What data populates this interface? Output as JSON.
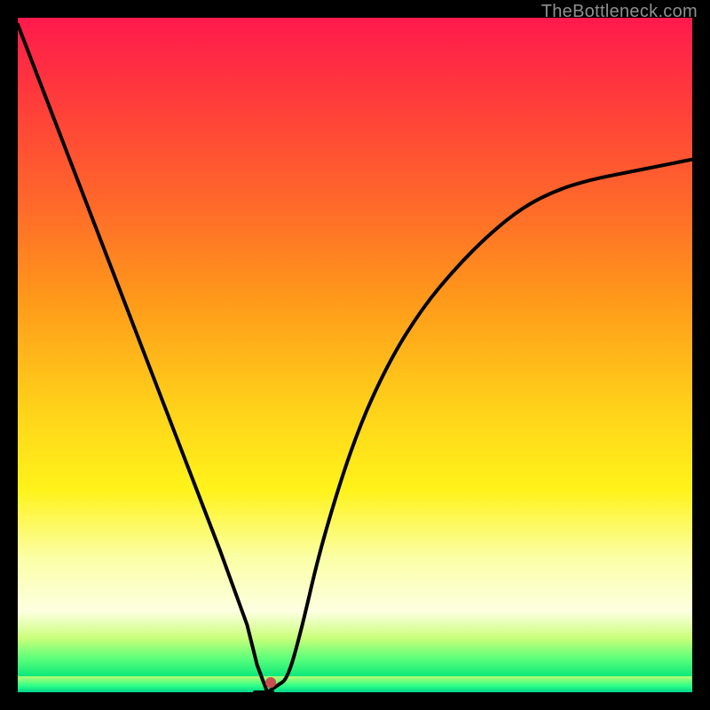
{
  "watermark": {
    "text": "TheBottleneck.com"
  },
  "colors": {
    "black": "#000000",
    "dot": "#c9504e",
    "watermark": "#8f8f8f"
  },
  "dot": {
    "x_frac": 0.375,
    "y_frac": 0.985
  },
  "chart_data": {
    "type": "line",
    "title": "",
    "xlabel": "",
    "ylabel": "",
    "xlim": [
      0,
      1
    ],
    "ylim": [
      0,
      1
    ],
    "note": "Axes not shown; x/y are fractional positions in the plot area. The plotted curve is a V-shaped bottleneck curve with minimum at x≈0.37, y≈0. The left branch is nearly straight, right branch rises concavely.",
    "series": [
      {
        "name": "bottleneck-curve",
        "x": [
          0.0,
          0.05,
          0.1,
          0.15,
          0.2,
          0.25,
          0.3,
          0.34,
          0.355,
          0.37,
          0.385,
          0.4,
          0.42,
          0.45,
          0.5,
          0.55,
          0.6,
          0.65,
          0.7,
          0.75,
          0.8,
          0.85,
          0.9,
          0.95,
          1.0
        ],
        "y": [
          0.99,
          0.86,
          0.73,
          0.6,
          0.47,
          0.34,
          0.21,
          0.1,
          0.04,
          0.0,
          0.01,
          0.02,
          0.09,
          0.22,
          0.38,
          0.49,
          0.57,
          0.63,
          0.68,
          0.72,
          0.745,
          0.76,
          0.77,
          0.78,
          0.79
        ]
      }
    ],
    "marker": {
      "x": 0.375,
      "y": 0.015,
      "color": "#c9504e"
    }
  }
}
